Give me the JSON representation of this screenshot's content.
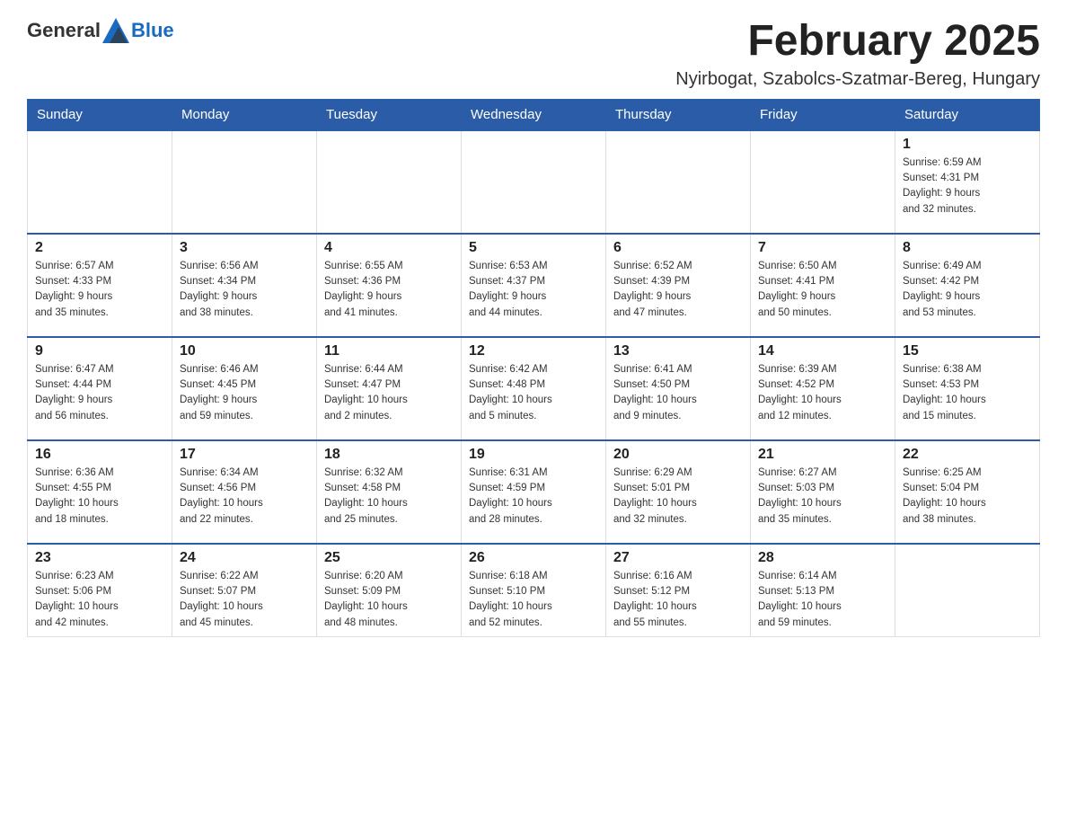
{
  "header": {
    "logo_general": "General",
    "logo_blue": "Blue",
    "month_title": "February 2025",
    "location": "Nyirbogat, Szabolcs-Szatmar-Bereg, Hungary"
  },
  "weekdays": [
    "Sunday",
    "Monday",
    "Tuesday",
    "Wednesday",
    "Thursday",
    "Friday",
    "Saturday"
  ],
  "weeks": [
    [
      {
        "day": "",
        "info": ""
      },
      {
        "day": "",
        "info": ""
      },
      {
        "day": "",
        "info": ""
      },
      {
        "day": "",
        "info": ""
      },
      {
        "day": "",
        "info": ""
      },
      {
        "day": "",
        "info": ""
      },
      {
        "day": "1",
        "info": "Sunrise: 6:59 AM\nSunset: 4:31 PM\nDaylight: 9 hours\nand 32 minutes."
      }
    ],
    [
      {
        "day": "2",
        "info": "Sunrise: 6:57 AM\nSunset: 4:33 PM\nDaylight: 9 hours\nand 35 minutes."
      },
      {
        "day": "3",
        "info": "Sunrise: 6:56 AM\nSunset: 4:34 PM\nDaylight: 9 hours\nand 38 minutes."
      },
      {
        "day": "4",
        "info": "Sunrise: 6:55 AM\nSunset: 4:36 PM\nDaylight: 9 hours\nand 41 minutes."
      },
      {
        "day": "5",
        "info": "Sunrise: 6:53 AM\nSunset: 4:37 PM\nDaylight: 9 hours\nand 44 minutes."
      },
      {
        "day": "6",
        "info": "Sunrise: 6:52 AM\nSunset: 4:39 PM\nDaylight: 9 hours\nand 47 minutes."
      },
      {
        "day": "7",
        "info": "Sunrise: 6:50 AM\nSunset: 4:41 PM\nDaylight: 9 hours\nand 50 minutes."
      },
      {
        "day": "8",
        "info": "Sunrise: 6:49 AM\nSunset: 4:42 PM\nDaylight: 9 hours\nand 53 minutes."
      }
    ],
    [
      {
        "day": "9",
        "info": "Sunrise: 6:47 AM\nSunset: 4:44 PM\nDaylight: 9 hours\nand 56 minutes."
      },
      {
        "day": "10",
        "info": "Sunrise: 6:46 AM\nSunset: 4:45 PM\nDaylight: 9 hours\nand 59 minutes."
      },
      {
        "day": "11",
        "info": "Sunrise: 6:44 AM\nSunset: 4:47 PM\nDaylight: 10 hours\nand 2 minutes."
      },
      {
        "day": "12",
        "info": "Sunrise: 6:42 AM\nSunset: 4:48 PM\nDaylight: 10 hours\nand 5 minutes."
      },
      {
        "day": "13",
        "info": "Sunrise: 6:41 AM\nSunset: 4:50 PM\nDaylight: 10 hours\nand 9 minutes."
      },
      {
        "day": "14",
        "info": "Sunrise: 6:39 AM\nSunset: 4:52 PM\nDaylight: 10 hours\nand 12 minutes."
      },
      {
        "day": "15",
        "info": "Sunrise: 6:38 AM\nSunset: 4:53 PM\nDaylight: 10 hours\nand 15 minutes."
      }
    ],
    [
      {
        "day": "16",
        "info": "Sunrise: 6:36 AM\nSunset: 4:55 PM\nDaylight: 10 hours\nand 18 minutes."
      },
      {
        "day": "17",
        "info": "Sunrise: 6:34 AM\nSunset: 4:56 PM\nDaylight: 10 hours\nand 22 minutes."
      },
      {
        "day": "18",
        "info": "Sunrise: 6:32 AM\nSunset: 4:58 PM\nDaylight: 10 hours\nand 25 minutes."
      },
      {
        "day": "19",
        "info": "Sunrise: 6:31 AM\nSunset: 4:59 PM\nDaylight: 10 hours\nand 28 minutes."
      },
      {
        "day": "20",
        "info": "Sunrise: 6:29 AM\nSunset: 5:01 PM\nDaylight: 10 hours\nand 32 minutes."
      },
      {
        "day": "21",
        "info": "Sunrise: 6:27 AM\nSunset: 5:03 PM\nDaylight: 10 hours\nand 35 minutes."
      },
      {
        "day": "22",
        "info": "Sunrise: 6:25 AM\nSunset: 5:04 PM\nDaylight: 10 hours\nand 38 minutes."
      }
    ],
    [
      {
        "day": "23",
        "info": "Sunrise: 6:23 AM\nSunset: 5:06 PM\nDaylight: 10 hours\nand 42 minutes."
      },
      {
        "day": "24",
        "info": "Sunrise: 6:22 AM\nSunset: 5:07 PM\nDaylight: 10 hours\nand 45 minutes."
      },
      {
        "day": "25",
        "info": "Sunrise: 6:20 AM\nSunset: 5:09 PM\nDaylight: 10 hours\nand 48 minutes."
      },
      {
        "day": "26",
        "info": "Sunrise: 6:18 AM\nSunset: 5:10 PM\nDaylight: 10 hours\nand 52 minutes."
      },
      {
        "day": "27",
        "info": "Sunrise: 6:16 AM\nSunset: 5:12 PM\nDaylight: 10 hours\nand 55 minutes."
      },
      {
        "day": "28",
        "info": "Sunrise: 6:14 AM\nSunset: 5:13 PM\nDaylight: 10 hours\nand 59 minutes."
      },
      {
        "day": "",
        "info": ""
      }
    ]
  ]
}
